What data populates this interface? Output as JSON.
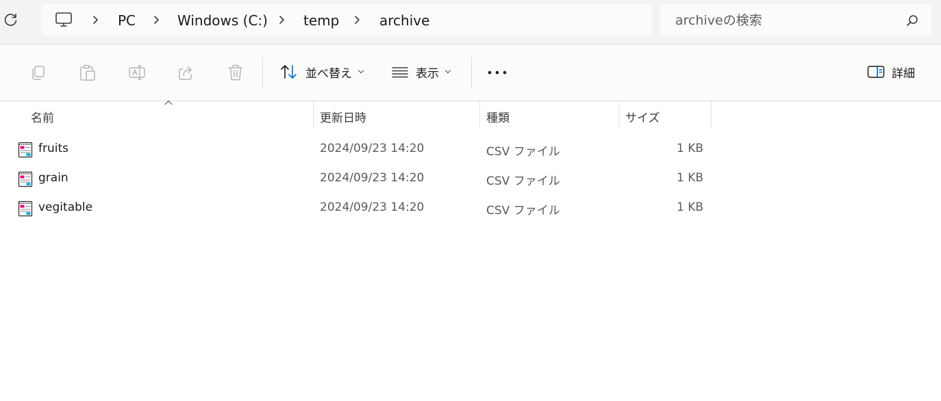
{
  "address": {
    "crumbs": [
      "PC",
      "Windows (C:)",
      "temp",
      "archive"
    ]
  },
  "search": {
    "placeholder": "archiveの検索"
  },
  "toolbar": {
    "sort_label": "並べ替え",
    "view_label": "表示",
    "details_label": "詳細"
  },
  "columns": {
    "name": "名前",
    "date": "更新日時",
    "type": "種類",
    "size": "サイズ"
  },
  "files": [
    {
      "name": "fruits",
      "date": "2024/09/23 14:20",
      "type": "CSV ファイル",
      "size": "1 KB"
    },
    {
      "name": "grain",
      "date": "2024/09/23 14:20",
      "type": "CSV ファイル",
      "size": "1 KB"
    },
    {
      "name": "vegitable",
      "date": "2024/09/23 14:20",
      "type": "CSV ファイル",
      "size": "1 KB"
    }
  ]
}
